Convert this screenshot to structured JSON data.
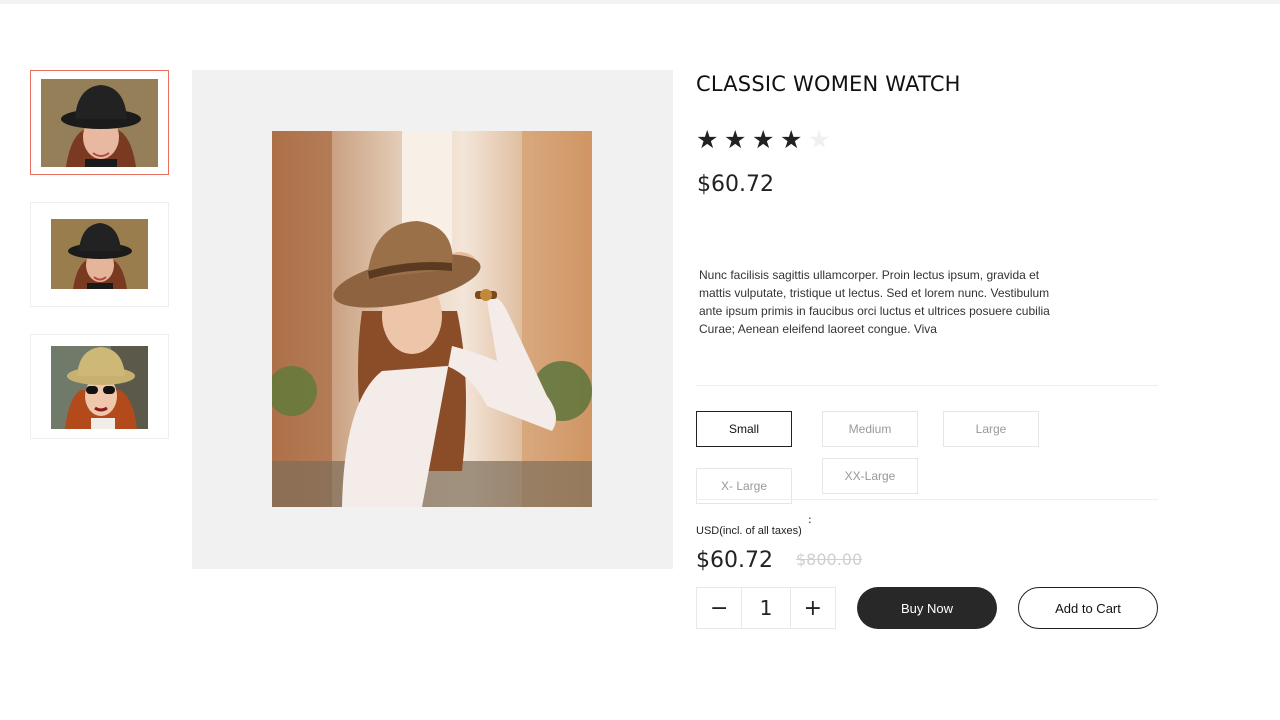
{
  "product": {
    "title": "CLASSIC WOMEN WATCH",
    "rating": 4,
    "rating_max": 5,
    "price": "$60.72",
    "description": "Nunc facilisis sagittis ullamcorper. Proin lectus ipsum, gravida et mattis vulputate, tristique ut lectus. Sed et lorem nunc. Vestibulum ante ipsum primis in faucibus orci luctus et ultrices posuere cubilia Curae; Aenean eleifend laoreet congue. Viva"
  },
  "sizes": {
    "options": [
      "Small",
      "Medium",
      "Large",
      "X- Large",
      "XX-Large"
    ],
    "selected": "Small"
  },
  "pricing": {
    "currency_label": "USD(incl. of all taxes)",
    "separator": ":",
    "current": "$60.72",
    "original": "$800.00"
  },
  "quantity": {
    "minus": "−",
    "value": "1",
    "plus": "+"
  },
  "actions": {
    "buy_now": "Buy Now",
    "add_to_cart": "Add to Cart"
  },
  "gallery": {
    "thumbnails": [
      {
        "alt": "black-hat-woman-photo",
        "active": true
      },
      {
        "alt": "black-hat-woman-photo-2",
        "active": false
      },
      {
        "alt": "yellow-hat-sunglasses-woman-photo",
        "active": false
      }
    ],
    "main_image": "woman-brown-hat-watch-photo"
  },
  "colors": {
    "active_thumb_border": "#e7705f",
    "buy_button": "#282828",
    "star_on": "#222222",
    "star_off": "#f0f0f0"
  }
}
